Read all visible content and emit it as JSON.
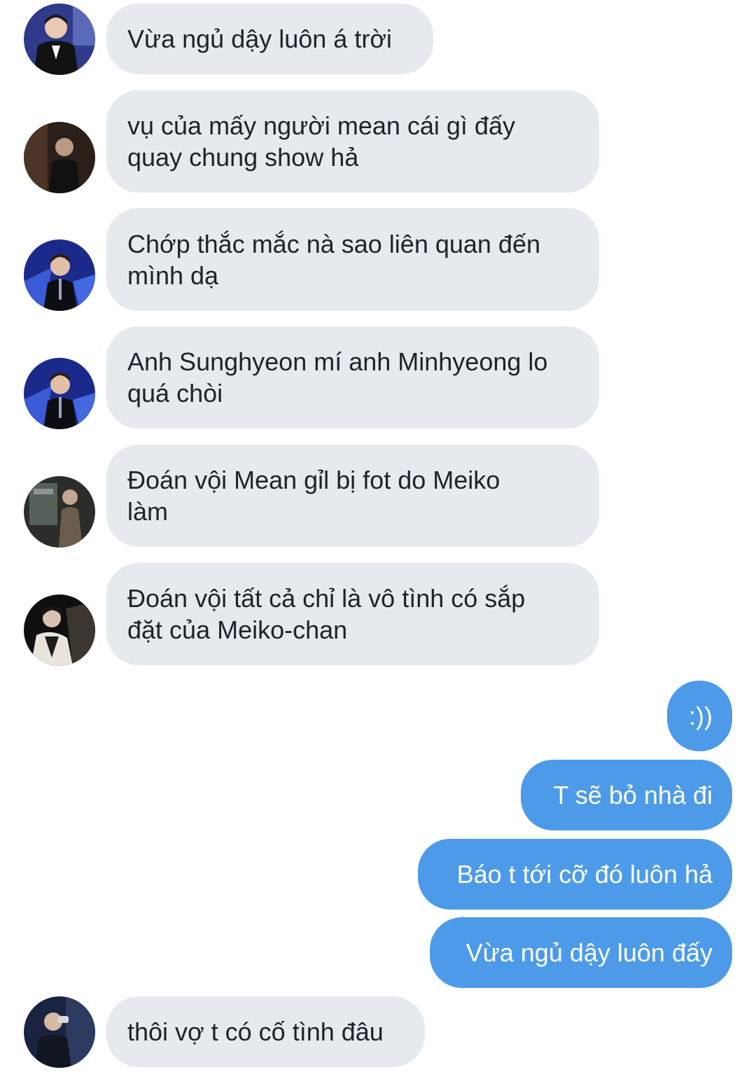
{
  "conversation": {
    "incoming": [
      {
        "text": "Vừa ngủ dậy luôn á trời",
        "avatar": "avatar-suit-event"
      },
      {
        "text": "vụ của mấy người mean cái gì đấy\nquay chung show hả",
        "avatar": "avatar-dark-room"
      },
      {
        "text": "Chớp thắc mắc nà sao liên quan đến\nmình dạ",
        "avatar": "avatar-stage-mic"
      },
      {
        "text": "Anh Sunghyeon mí anh Minhyeong lo\nquá chòi",
        "avatar": "avatar-stage-mic"
      },
      {
        "text": "Đoán vội Mean gỉl bị fot do Meiko\nlàm",
        "avatar": "avatar-shop-window"
      },
      {
        "text": "Đoán vội tất cả chỉ là vô tình có sắp\nđặt của Meiko-chan",
        "avatar": "avatar-sofa-portrait"
      }
    ],
    "outgoing": [
      {
        "text": ":))"
      },
      {
        "text": "T sẽ bỏ nhà đi"
      },
      {
        "text": "Báo t tới cỡ đó luôn hả"
      },
      {
        "text": "Vừa ngủ dậy luôn đấy"
      }
    ],
    "last_incoming": {
      "text": "thôi vợ t có cố tình đâu",
      "avatar": "avatar-drinking"
    }
  },
  "colors": {
    "incoming_bubble": "#e6e9ed",
    "outgoing_bubble": "#4d9be8",
    "incoming_text": "#1f2328",
    "outgoing_text": "#ffffff"
  }
}
